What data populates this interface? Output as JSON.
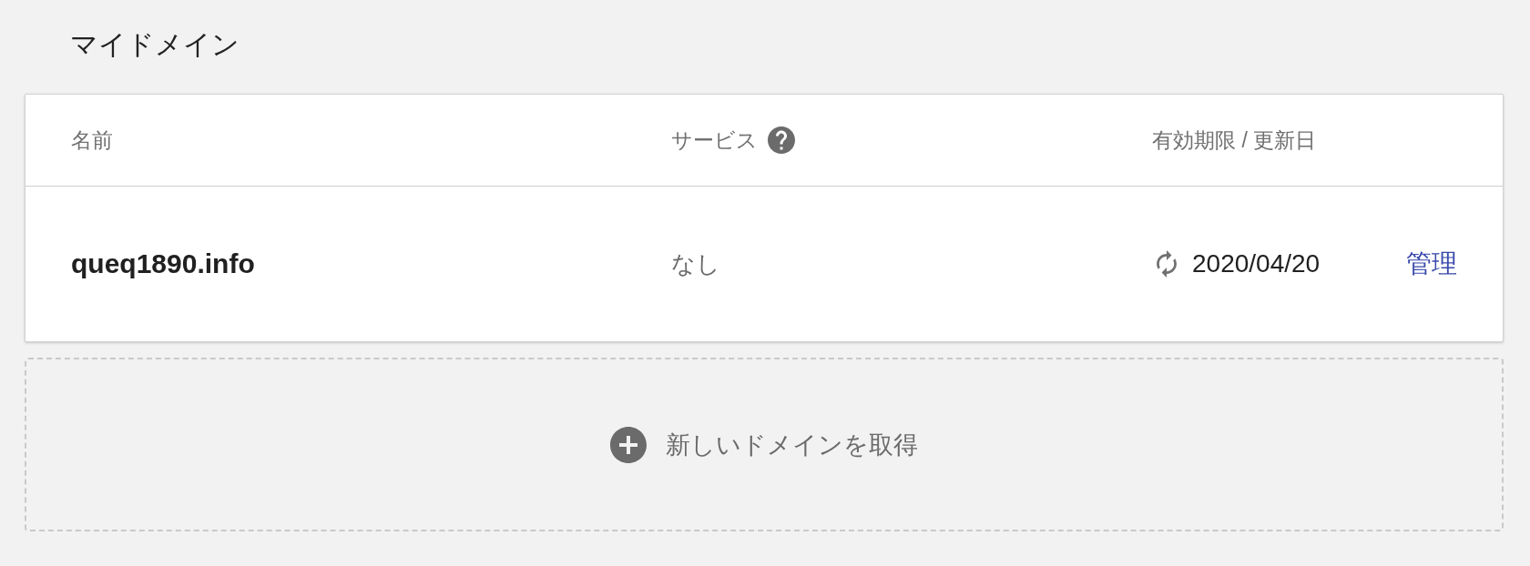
{
  "page": {
    "title": "マイドメイン"
  },
  "table": {
    "columns": [
      {
        "label": "名前",
        "help": false
      },
      {
        "label": "サービス",
        "help": true
      },
      {
        "label": "有効期限 / 更新日",
        "help": false
      }
    ],
    "rows": [
      {
        "name": "queq1890.info",
        "service": "なし",
        "auto_renew": true,
        "date": "2020/04/20",
        "action": "管理"
      }
    ]
  },
  "add_button": {
    "label": "新しいドメインを取得"
  }
}
